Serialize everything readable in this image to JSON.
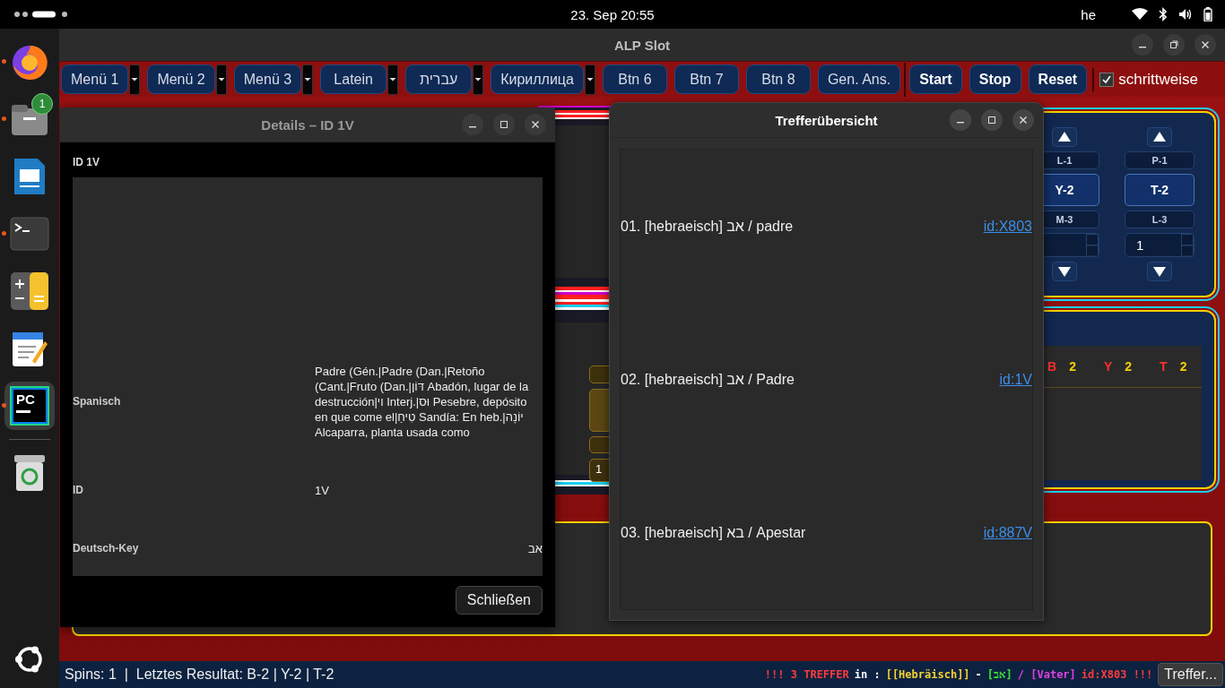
{
  "system_bar": {
    "clock": "23. Sep  20:55",
    "keyboard": "he"
  },
  "dock": {
    "items": [
      {
        "kind": "firefox",
        "running": true,
        "selected": false
      },
      {
        "kind": "files",
        "running": true,
        "selected": false,
        "badge": "1"
      },
      {
        "kind": "writer",
        "running": false,
        "selected": false
      },
      {
        "kind": "terminal",
        "running": true,
        "selected": false
      },
      {
        "kind": "calculator",
        "running": false,
        "selected": false
      },
      {
        "kind": "editor",
        "running": false,
        "selected": false
      },
      {
        "kind": "pycharm",
        "running": true,
        "selected": true,
        "label": "PC"
      },
      {
        "kind": "trash",
        "running": false,
        "selected": false
      }
    ]
  },
  "window": {
    "title": "ALP Slot"
  },
  "toolbar": {
    "menus": [
      {
        "label": "Menü 1"
      },
      {
        "label": "Menü 2"
      },
      {
        "label": "Menü 3"
      },
      {
        "label": "Latein"
      },
      {
        "label": "עברית"
      },
      {
        "label": "Кириллица"
      }
    ],
    "buttons": [
      "Btn 6",
      "Btn 7",
      "Btn 8",
      "Gen. Ans."
    ],
    "actions": [
      "Start",
      "Stop",
      "Reset"
    ],
    "step_checkbox": {
      "label": "schrittweise",
      "checked": true
    }
  },
  "reels": [
    {
      "top": "L-1",
      "center": "Y-2",
      "bottom": "M-3"
    },
    {
      "top": "P-1",
      "center": "T-2",
      "bottom": "L-3",
      "spin_value": "1"
    }
  ],
  "gold_tile_value": "1",
  "result_row": [
    {
      "letter": "B",
      "count": "2"
    },
    {
      "letter": "Y",
      "count": "2"
    },
    {
      "letter": "T",
      "count": "2"
    }
  ],
  "details_dialog": {
    "title": "Details – ID 1V",
    "heading": "ID 1V",
    "rows": [
      {
        "label": "Spanisch",
        "value": "Padre (Gén.|Padre (Dan.|Retoño (Cant.|Fruto (Dan.|דּוֹן Abadón, lugar de la destrucción|וי Interj.|וּס Pesebre, depósito en que come el|טִיחַ Sandía: En heb.|יוֹנָה Alcaparra, planta usada como"
      },
      {
        "label": "ID",
        "value": "1V"
      },
      {
        "label": "Deutsch-Key",
        "value": "אב"
      }
    ],
    "close_button": "Schließen"
  },
  "hits_dialog": {
    "title": "Trefferübersicht",
    "hits": [
      {
        "text": "01. [hebraeisch] אב / padre",
        "link": "id:X803"
      },
      {
        "text": "02. [hebraeisch] אב / Padre",
        "link": "id:1V"
      },
      {
        "text": "03. [hebraeisch] בא / Apestar",
        "link": "id:887V"
      }
    ]
  },
  "status_bar": {
    "text": "Spins: 1  |  Letztes Resultat: B-2 | Y-2 | T-2",
    "message": [
      {
        "text": "!!! 3 TREFFER",
        "color": "#ff3b3b"
      },
      {
        "text": "in :",
        "color": "#ffffff"
      },
      {
        "text": "[[Hebräisch]]",
        "color": "#f5d130"
      },
      {
        "text": "-",
        "color": "#ffffff"
      },
      {
        "text": "[אב]",
        "color": "#3ee03e"
      },
      {
        "text": "/ [Vater]",
        "color": "#e040e0"
      },
      {
        "text": "id:X803 !!!",
        "color": "#ff3b3b"
      }
    ],
    "button": "Treffer..."
  }
}
